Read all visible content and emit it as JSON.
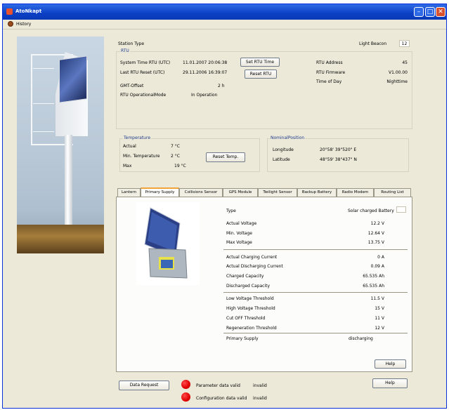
{
  "window": {
    "title": "AtoNkapt"
  },
  "menu": {
    "history_label": "History"
  },
  "station": {
    "type_label": "Station Type",
    "type_value": "Light Beacon",
    "type_code": "12"
  },
  "rtu": {
    "group_label": "RTU",
    "system_time_label": "System Time RTU (UTC)",
    "system_time_value": "11.01.2007 20:06:38",
    "last_reset_label": "Last RTU Reset (UTC)",
    "last_reset_value": "29.11.2006 16:39:07",
    "gmt_offset_label": "GMT-Offset",
    "gmt_offset_value": "2 h",
    "operational_mode_label": "RTU OperationalMode",
    "operational_mode_value": "In Operation",
    "set_time_button": "Set RTU Time",
    "reset_button": "Reset RTU",
    "address_label": "RTU Address",
    "address_value": "45",
    "firmware_label": "RTU Firmware",
    "firmware_value": "V1.00.00",
    "time_of_day_label": "Time of Day",
    "time_of_day_value": "Nighttime"
  },
  "temperature": {
    "group_label": "Temperature",
    "actual_label": "Actual",
    "actual_value": "7 °C",
    "min_label": "Min. Temperature",
    "min_value": "2 °C",
    "max_label": "Max",
    "max_value": "19 °C",
    "reset_button": "Reset Temp."
  },
  "position": {
    "group_label": "NominalPosition",
    "longitude_label": "Longitude",
    "longitude_value": "20°58' 39\"520\" E",
    "latitude_label": "Latitude",
    "latitude_value": "48°59' 38\"437\" N"
  },
  "tabs": [
    "Lantern",
    "Primary Supply",
    "Collisions Sensor",
    "GPS Module",
    "Twilight Sensor",
    "Backup Battery",
    "Radio Modem",
    "Routing List"
  ],
  "supply": {
    "type_label": "Type",
    "type_value": "Solar charged Battery",
    "rows1": [
      {
        "label": "Actual Voltage",
        "value": "12.2 V"
      },
      {
        "label": "Min. Voltage",
        "value": "12.64 V"
      },
      {
        "label": "Max Voltage",
        "value": "13.75 V"
      }
    ],
    "rows2": [
      {
        "label": "Actual Charging Current",
        "value": "0 A"
      },
      {
        "label": "Actual Discharging Current",
        "value": "0.09 A"
      },
      {
        "label": "Charged Capacity",
        "value": "65.535 Ah"
      },
      {
        "label": "Discharged Capacity",
        "value": "65.535 Ah"
      }
    ],
    "rows3": [
      {
        "label": "Low Voltage Threshold",
        "value": "11.5 V"
      },
      {
        "label": "High Voltage Threshold",
        "value": "15 V"
      },
      {
        "label": "Cut OFF Threshold",
        "value": "11 V"
      },
      {
        "label": "Regeneration Threshold",
        "value": "12 V"
      }
    ],
    "primary_label": "Primary Supply",
    "primary_value": "discharging",
    "help_button": "Help"
  },
  "footer": {
    "data_request_button": "Data Request",
    "param_label": "Parameter data valid",
    "param_value": "invalid",
    "config_label": "Configuration data valid",
    "config_value": "invalid",
    "help_button": "Help"
  },
  "colors": {
    "title_bar": "#0b3fc4",
    "led_invalid": "#e10000",
    "active_tab": "#f0a53a"
  }
}
